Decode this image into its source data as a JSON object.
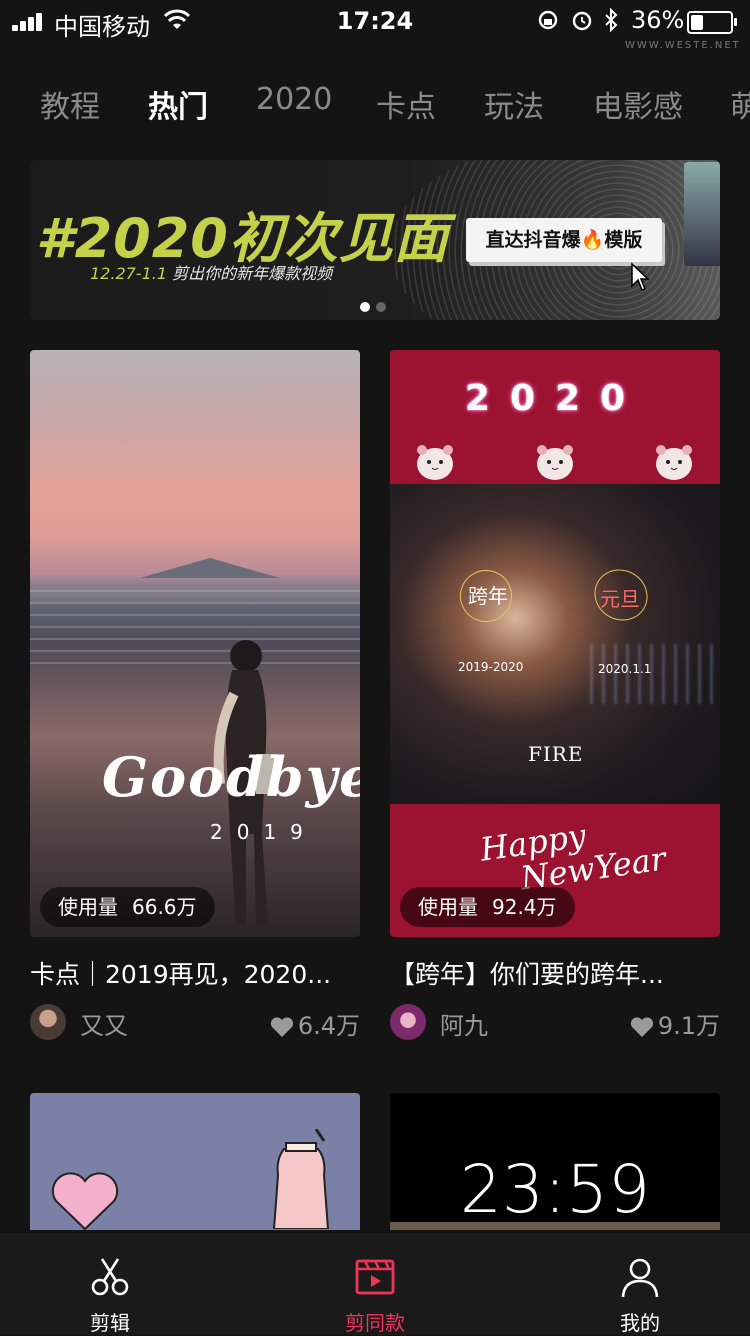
{
  "status_bar": {
    "carrier": "中国移动",
    "time": "17:24",
    "battery_percent": "36%",
    "battery_level": 0.36,
    "watermark": "WWW.WESTE.NET"
  },
  "tabs": [
    {
      "label": "教程"
    },
    {
      "label": "热门",
      "active": true
    },
    {
      "label": "2020"
    },
    {
      "label": "卡点"
    },
    {
      "label": "玩法"
    },
    {
      "label": "电影感"
    },
    {
      "label": "萌"
    }
  ],
  "banner": {
    "title": "#2020初次见面",
    "date": "12.27-1.1",
    "subtitle": "剪出你的新年爆款视频",
    "cta": "直达抖音爆🔥模版",
    "page_indicator": {
      "count": 2,
      "active": 1
    }
  },
  "cards": [
    {
      "usage_label": "使用量",
      "usage_value": "66.6万",
      "overlay_text": "Goodbye",
      "overlay_year": "2019",
      "title": "卡点｜2019再见，2020...",
      "author": "又又",
      "likes": "6.4万"
    },
    {
      "usage_label": "使用量",
      "usage_value": "92.4万",
      "overlay_year": "2020",
      "overlay_left": "跨年",
      "overlay_right": "元旦",
      "date_left": "2019-2020",
      "date_right": "2020.1.1",
      "overlay_fire": "FIRE",
      "overlay_happy": "Happy",
      "overlay_newyear": "NewYear",
      "title": "【跨年】你们要的跨年...",
      "author": "阿九",
      "likes": "9.1万"
    }
  ],
  "bottom_cards": [
    {
      "overlay_text": "23:59"
    }
  ],
  "bottom_nav": [
    {
      "label": "剪辑",
      "icon": "scissors-icon"
    },
    {
      "label": "剪同款",
      "icon": "film-play-icon",
      "active": true
    },
    {
      "label": "我的",
      "icon": "person-icon"
    }
  ],
  "colors": {
    "accent": "#f2335a",
    "banner_text": "#c6d14a",
    "card_red": "#9b1330",
    "background": "#141414"
  }
}
